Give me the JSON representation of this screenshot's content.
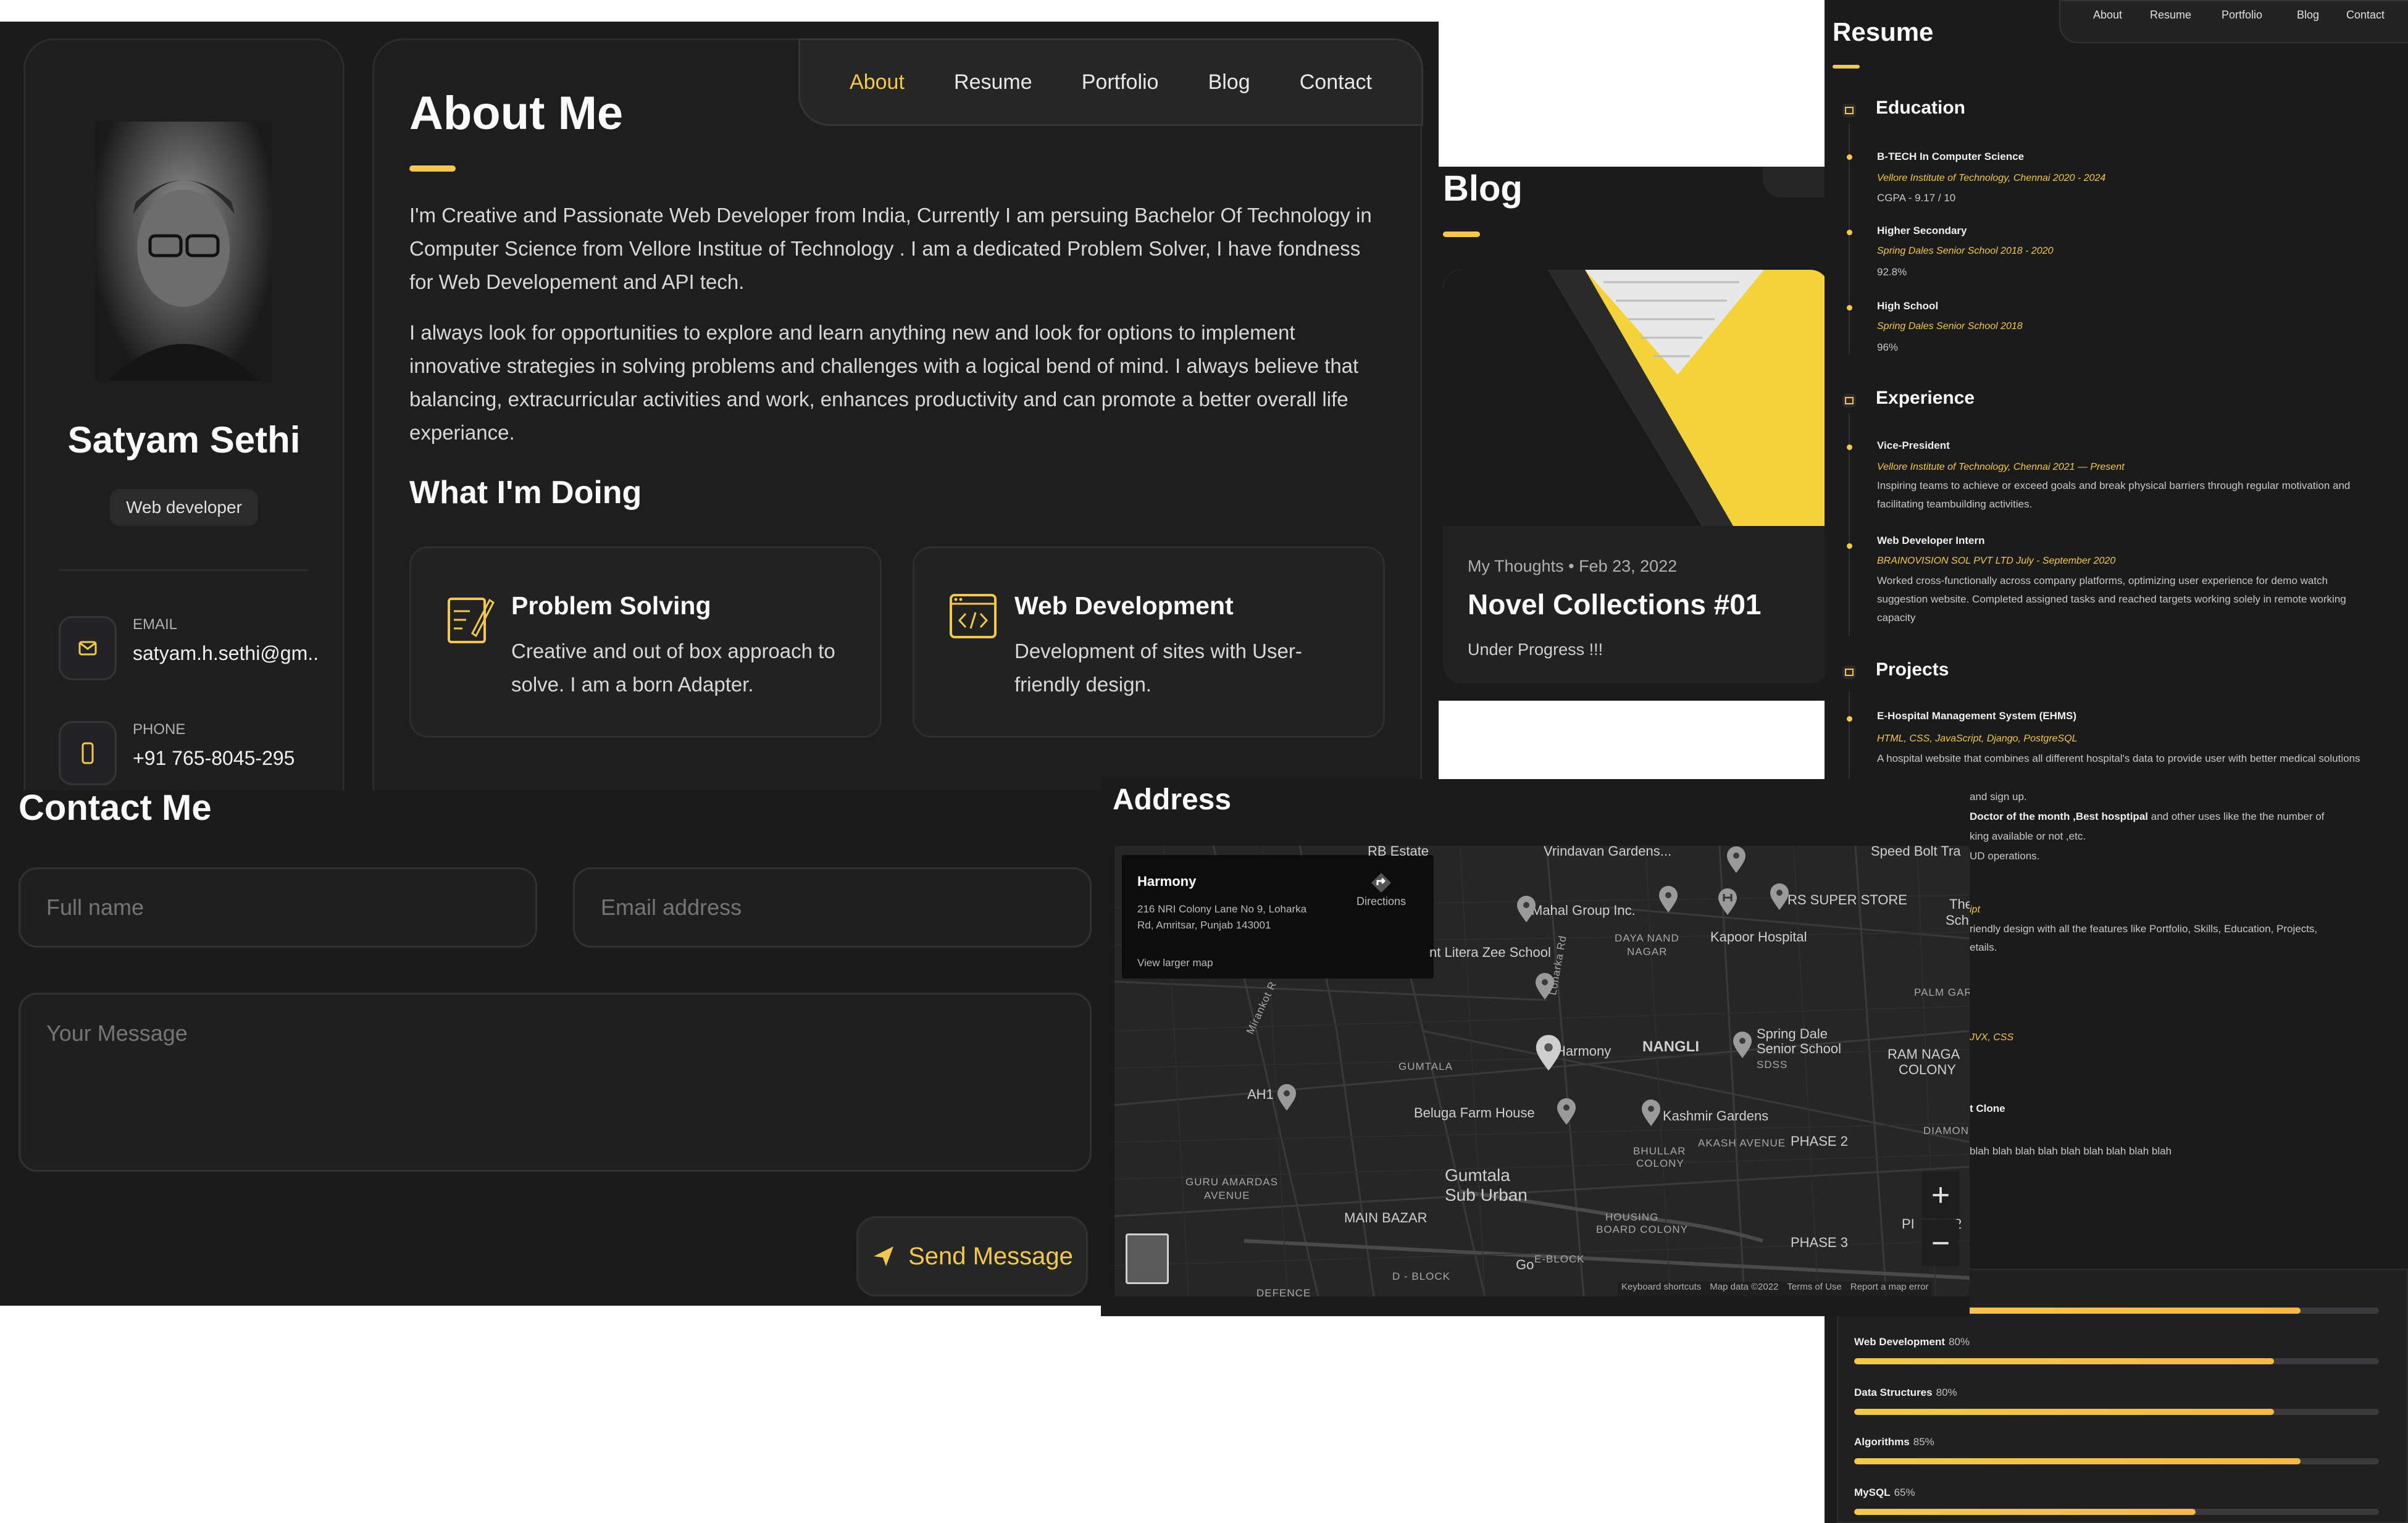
{
  "about": {
    "profile": {
      "name": "Satyam Sethi",
      "role": "Web developer",
      "contacts": [
        {
          "label": "EMAIL",
          "value": "satyam.h.sethi@gm...",
          "icon": "mail-icon"
        },
        {
          "label": "PHONE",
          "value": "+91 765-8045-295",
          "icon": "phone-icon"
        }
      ]
    },
    "nav": [
      "About",
      "Resume",
      "Portfolio",
      "Blog",
      "Contact"
    ],
    "nav_active": "About",
    "title": "About Me",
    "paragraphs": [
      "I'm Creative and Passionate Web Developer from India, Currently I am persuing Bachelor Of Technology in Computer Science from Vellore Institue of Technology . I am a dedicated Problem Solver, I have fondness for Web Developement and API tech.",
      "I always look for opportunities to explore and learn anything new and look for options to implement innovative strategies in solving problems and challenges with a logical bend of mind. I always believe that balancing, extracurricular activities and work, enhances productivity and can promote a better overall life experiance."
    ],
    "doing_title": "What I'm Doing",
    "services": [
      {
        "title": "Problem Solving",
        "desc": "Creative and out of box approach to solve. I am a born Adapter.",
        "icon": "design-pencil-icon"
      },
      {
        "title": "Web Development",
        "desc": "Development of sites with User-friendly design.",
        "icon": "code-window-icon"
      }
    ]
  },
  "blog": {
    "title": "Blog",
    "post": {
      "category": "My Thoughts",
      "date": "Feb 23, 2022",
      "title": "Novel Collections #01",
      "desc": "Under Progress !!!"
    }
  },
  "resume": {
    "title": "Resume",
    "nav": [
      "About",
      "Resume",
      "Portfolio",
      "Blog",
      "Contact"
    ],
    "nav_active": "Resume",
    "education": {
      "title": "Education",
      "items": [
        {
          "title": "B-TECH In Computer Science",
          "inst": "Vellore Institute of Technology, Chennai   2020 - 2024",
          "detail": "CGPA - 9.17 / 10"
        },
        {
          "title": "Higher Secondary",
          "inst": "Spring Dales Senior School   2018 - 2020",
          "detail": "92.8%"
        },
        {
          "title": "High School",
          "inst": "Spring Dales Senior School   2018",
          "detail": "96%"
        }
      ]
    },
    "experience": {
      "title": "Experience",
      "items": [
        {
          "title": "Vice-President",
          "inst": "Vellore Institute of Technology, Chennai   2021 — Present",
          "detail": "Inspiring teams to achieve or exceed goals and break physical barriers through regular motivation and facilitating teambuilding activities."
        },
        {
          "title": "Web Developer Intern",
          "inst": "BRAINOVISION SOL PVT LTD   July - September 2020",
          "detail": "Worked cross-functionally across company platforms, optimizing user experience for demo watch suggestion website. Completed assigned tasks and reached targets working solely in remote working capacity"
        }
      ]
    },
    "projects": {
      "title": "Projects",
      "items": [
        {
          "title": "E-Hospital Management System (EHMS)",
          "inst": "HTML, CSS, JavaScript, Django, PostgreSQL",
          "detail": "A hospital website that combines all different hospital's data to provide user with better medical solutions"
        }
      ],
      "fragments": [
        "and sign up.",
        "Doctor of the month ,Best hosptipal",
        "and other uses like the the number of",
        "king available or not ,etc.",
        "UD operations.",
        "ipt",
        "riendly design with all the features like Portfolio, Skills, Education, Projects,",
        "etails.",
        "JVX, CSS",
        "t Clone",
        "blah blah blah blah blah blah blah blah blah"
      ]
    },
    "skills": [
      {
        "name": "Web Development",
        "pct": 80
      },
      {
        "name": "Data Structures",
        "pct": 80
      },
      {
        "name": "Algorithms",
        "pct": 85
      },
      {
        "name": "MySQL",
        "pct": 65
      }
    ],
    "skill_top_fill": 85
  },
  "contact": {
    "title": "Contact Me",
    "fullname_placeholder": "Full name",
    "email_placeholder": "Email address",
    "message_placeholder": "Your Message",
    "send_label": "Send Message"
  },
  "address": {
    "title": "Address",
    "info": {
      "place": "Harmony",
      "address_line1": "216 NRI Colony Lane No 9, Loharka",
      "address_line2": "Rd, Amritsar, Punjab 143001",
      "directions": "Directions",
      "larger_map": "View larger map"
    },
    "map_labels": {
      "rb_estate": "RB Estate",
      "vrindavan": "Vrindavan Gardens...",
      "speed_bolt": "Speed Bolt Tra",
      "mahal": "Mahal Group Inc.",
      "rs_store": "RS SUPER STORE",
      "kapoor": "Kapoor Hospital",
      "litera": "nt Litera Zee School",
      "harmony": "Harmony",
      "nangli": "NANGLI",
      "spring_dale": "Spring Dale",
      "senior_school": "Senior School",
      "beluga": "Beluga Farm House",
      "kashmir": "Kashmir Gardens",
      "gumtala": "Gumtala",
      "sub_urban": "Sub Urban",
      "main_bazar": "MAIN BAZAR",
      "ah1": "AH1",
      "gumtala_small": "GUMTALA",
      "guru_amardas": "GURU AMARDAS",
      "avenue": "AVENUE",
      "daya_nand": "DAYA NAND",
      "nagar": "NAGAR",
      "palm_gard": "PALM GARI",
      "ram_naga": "RAM NAGA",
      "colony": "COLONY",
      "diamon": "DIAMON",
      "akash": "AKASH AVENUE",
      "bhullar": "BHULLAR",
      "bhullar_colony": "COLONY",
      "phase2": "PHASE 2",
      "phase3": "PHASE 3",
      "housing": "HOUSING",
      "board_colony": "BOARD COLONY",
      "d_block": "D - BLOCK",
      "e_block": "E-BLOCK",
      "defence": "DEFENCE",
      "sdss": "SDSS",
      "the_sch": "The",
      "sch": "Sch",
      "p2": "PI",
      "p2b": "2",
      "go": "Go",
      "loharka_rd": "Loharka Rd",
      "mirankot": "Mirankot R"
    },
    "footer": {
      "shortcuts": "Keyboard shortcuts",
      "mapdata": "Map data ©2022",
      "terms": "Terms of Use",
      "report": "Report a map error"
    },
    "zoom_in": "+",
    "zoom_out": "−"
  },
  "colors": {
    "accent": "#f2c94c",
    "panel_bg": "#1b1b1c",
    "card_bg": "#1e1e1f"
  }
}
